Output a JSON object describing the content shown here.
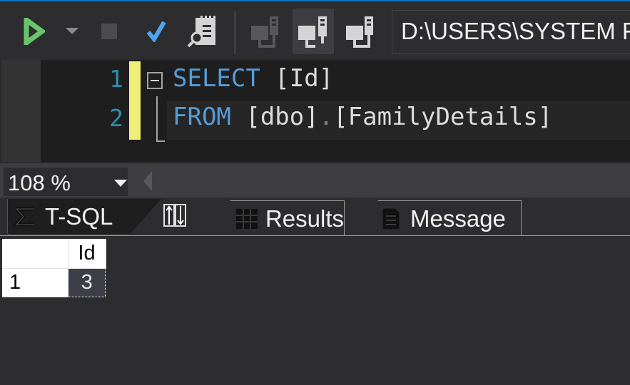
{
  "toolbar": {
    "buttons": [
      {
        "name": "execute",
        "icon": "play-icon",
        "color": "#6ac46d"
      },
      {
        "name": "execute-dropdown",
        "icon": "chevron-down-icon"
      },
      {
        "name": "stop",
        "icon": "stop-icon"
      },
      {
        "name": "parse",
        "icon": "check-icon",
        "color": "#4fa6f0"
      },
      {
        "name": "estimated-plan",
        "icon": "plan-icon"
      },
      {
        "name": "connect",
        "icon": "connect-icon"
      },
      {
        "name": "change-connection",
        "icon": "change-connection-icon",
        "active": true
      },
      {
        "name": "disconnect",
        "icon": "disconnect-icon"
      }
    ],
    "connection": "D:\\USERS\\SYSTEM FILES\\"
  },
  "editor": {
    "lines": [
      {
        "number": "1",
        "keyword": "SELECT",
        "rest": " [Id]"
      },
      {
        "number": "2",
        "keyword": "FROM",
        "rest_a": " [dbo]",
        "dot": ".",
        "rest_b": "[FamilyDetails]"
      }
    ]
  },
  "status": {
    "zoom": "108 %"
  },
  "tabs": [
    {
      "label": "T-SQL",
      "icon": "tsql-icon",
      "active": true
    },
    {
      "label": "",
      "icon": "execution-plan-icon"
    },
    {
      "label": "Results",
      "icon": "grid-icon"
    },
    {
      "label": "Message",
      "icon": "document-icon"
    }
  ],
  "results": {
    "columns": [
      "Id"
    ],
    "rows": [
      {
        "row_number": "1",
        "values": [
          "3"
        ]
      }
    ]
  }
}
